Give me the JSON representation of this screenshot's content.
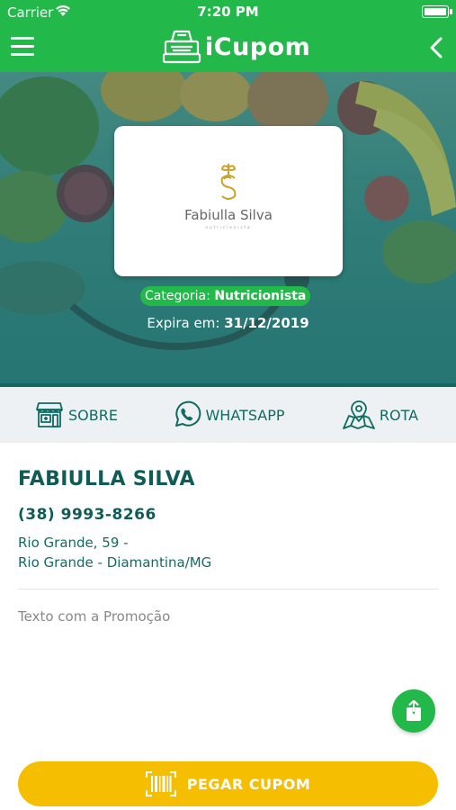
{
  "status_bar": {
    "carrier": "Carrier",
    "time": "7:20 PM",
    "battery_level": 1.0
  },
  "header": {
    "app_name": "iCupom",
    "menu_icon": "hamburger-menu-icon",
    "back_icon": "chevron-left-icon",
    "logo_icon": "cash-register-icon"
  },
  "colors": {
    "primary_green": "#22b84a",
    "dark_teal": "#0f5c56",
    "accent_yellow": "#f6be00",
    "action_bar_bg": "#edf1f3"
  },
  "store": {
    "logo_name": "Fabiulla Silva",
    "logo_subtitle": "nutricionista",
    "category_label": "Categoria:",
    "category_value": "Nutricionista",
    "expire_label": "Expira em:",
    "expire_date": "31/12/2019"
  },
  "actions": [
    {
      "label": "SOBRE",
      "icon": "storefront-icon"
    },
    {
      "label": "WHATSAPP",
      "icon": "whatsapp-icon"
    },
    {
      "label": "ROTA",
      "icon": "map-pin-icon"
    }
  ],
  "details": {
    "name": "FABIULLA SILVA",
    "phone": "(38) 9993-8266",
    "address_line1": "Rio Grande, 59 -",
    "address_line2": "Rio Grande - Diamantina/MG",
    "promo_text": "Texto com a Promoção"
  },
  "cta": {
    "label": "PEGAR CUPOM",
    "icon": "barcode-icon"
  },
  "share_icon": "share-icon"
}
